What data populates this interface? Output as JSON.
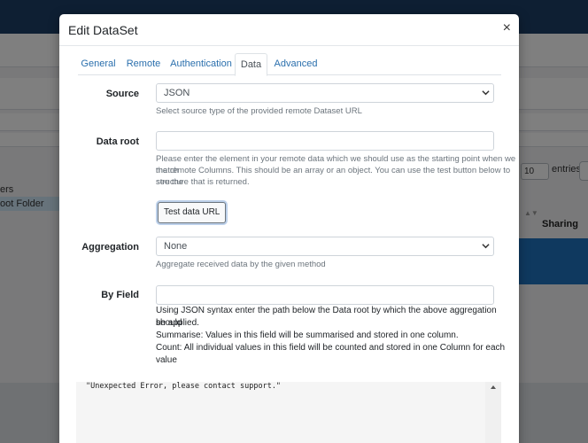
{
  "background": {
    "left_items": [
      "ers",
      "oot Folder"
    ],
    "page_length": "10",
    "entries_label": "entries",
    "column_sharing": "Sharing"
  },
  "modal": {
    "title": "Edit DataSet",
    "close_glyph": "×",
    "tabs": [
      {
        "label": "General",
        "active": false
      },
      {
        "label": "Remote",
        "active": false
      },
      {
        "label": "Authentication",
        "active": false
      },
      {
        "label": "Data",
        "active": true
      },
      {
        "label": "Advanced",
        "active": false
      }
    ],
    "source": {
      "label": "Source",
      "value": "JSON",
      "help": "Select source type of the provided remote Dataset URL"
    },
    "data_root": {
      "label": "Data root",
      "value": "",
      "help_line1": "Please enter the element in your remote data which we should use as the starting point when we match",
      "help_line2": "the remote Columns. This should be an array or an object. You can use the test button below to see the",
      "help_line3": "structure that is returned."
    },
    "test_button": "Test data URL",
    "aggregation": {
      "label": "Aggregation",
      "value": "None",
      "help": "Aggregate received data by the given method"
    },
    "by_field": {
      "label": "By Field",
      "value": "",
      "help_line1": "Using JSON syntax enter the path below the Data root by which the above aggregation should",
      "help_line2": "be applied.",
      "help_line3": "Summarise: Values in this field will be summarised and stored in one column.",
      "help_line4": "Count: All individual values in this field will be counted and stored in one Column for each",
      "help_line5": "value"
    },
    "output": "\"Unexpected Error, please contact support.\""
  },
  "colors": {
    "topbar": "#1d3f66",
    "link": "#2a6fad",
    "highlight_row": "#1e73be"
  }
}
